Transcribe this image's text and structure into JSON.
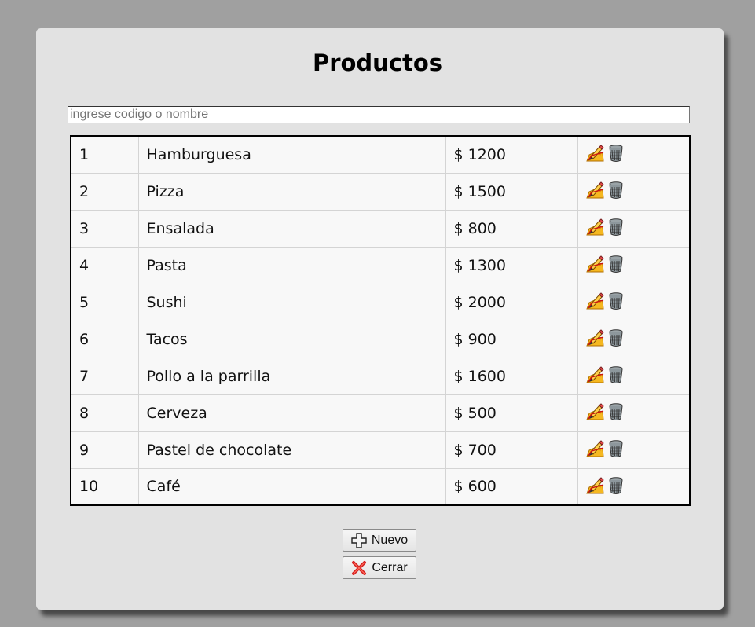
{
  "page": {
    "title": "Productos"
  },
  "search": {
    "placeholder": "ingrese codigo o nombre",
    "value": ""
  },
  "products": [
    {
      "id": "1",
      "name": "Hamburguesa",
      "price": "$ 1200"
    },
    {
      "id": "2",
      "name": "Pizza",
      "price": "$ 1500"
    },
    {
      "id": "3",
      "name": "Ensalada",
      "price": "$ 800"
    },
    {
      "id": "4",
      "name": "Pasta",
      "price": "$ 1300"
    },
    {
      "id": "5",
      "name": "Sushi",
      "price": "$ 2000"
    },
    {
      "id": "6",
      "name": "Tacos",
      "price": "$ 900"
    },
    {
      "id": "7",
      "name": "Pollo a la parrilla",
      "price": "$ 1600"
    },
    {
      "id": "8",
      "name": "Cerveza",
      "price": "$ 500"
    },
    {
      "id": "9",
      "name": "Pastel de chocolate",
      "price": "$ 700"
    },
    {
      "id": "10",
      "name": "Café",
      "price": "$ 600"
    }
  ],
  "row_actions": {
    "edit_icon": "pencil-edit-icon",
    "delete_icon": "trash-can-icon"
  },
  "buttons": {
    "new_label": "Nuevo",
    "new_icon": "plus-icon",
    "close_label": "Cerrar",
    "close_icon": "red-x-icon"
  },
  "colors": {
    "background": "#a0a0a0",
    "panel": "#e2e2e2",
    "table_bg": "#f8f8f8",
    "close_icon_red": "#d42020"
  }
}
